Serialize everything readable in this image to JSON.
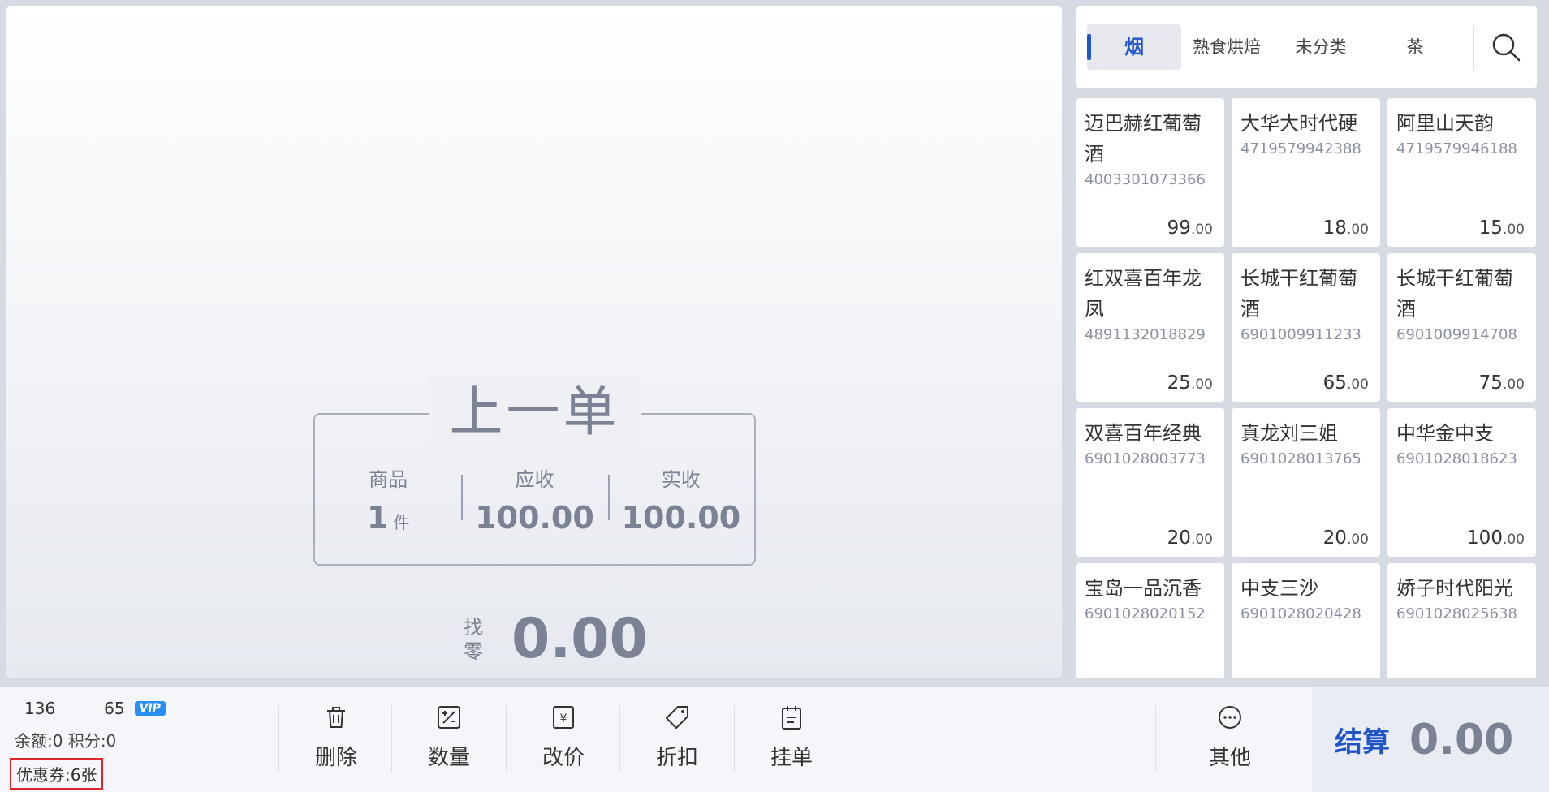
{
  "last_order": {
    "title": "上一单",
    "goods_label": "商品",
    "goods_count": "1",
    "goods_unit": "件",
    "receivable_label": "应收",
    "receivable_value": "100.00",
    "received_label": "实收",
    "received_value": "100.00",
    "change_label": "找零",
    "change_value": "0.00"
  },
  "categories": [
    {
      "label": "烟",
      "active": true
    },
    {
      "label": "熟食烘焙",
      "active": false
    },
    {
      "label": "未分类",
      "active": false
    },
    {
      "label": "茶",
      "active": false
    }
  ],
  "products": [
    {
      "name": "迈巴赫红葡萄酒",
      "code": "4003301073366",
      "price_int": "99",
      "price_dec": ".00"
    },
    {
      "name": "大华大时代硬",
      "code": "4719579942388",
      "price_int": "18",
      "price_dec": ".00"
    },
    {
      "name": "阿里山天韵",
      "code": "4719579946188",
      "price_int": "15",
      "price_dec": ".00"
    },
    {
      "name": "红双喜百年龙凤",
      "code": "4891132018829",
      "price_int": "25",
      "price_dec": ".00"
    },
    {
      "name": "长城干红葡萄酒",
      "code": "6901009911233",
      "price_int": "65",
      "price_dec": ".00"
    },
    {
      "name": "长城干红葡萄酒",
      "code": "6901009914708",
      "price_int": "75",
      "price_dec": ".00"
    },
    {
      "name": "双喜百年经典",
      "code": "6901028003773",
      "price_int": "20",
      "price_dec": ".00"
    },
    {
      "name": "真龙刘三姐",
      "code": "6901028013765",
      "price_int": "20",
      "price_dec": ".00"
    },
    {
      "name": "中华金中支",
      "code": "6901028018623",
      "price_int": "100",
      "price_dec": ".00"
    },
    {
      "name": "宝岛一品沉香",
      "code": "6901028020152",
      "price_int": "",
      "price_dec": ""
    },
    {
      "name": "中支三沙",
      "code": "6901028020428",
      "price_int": "",
      "price_dec": ""
    },
    {
      "name": "娇子时代阳光",
      "code": "6901028025638",
      "price_int": "",
      "price_dec": ""
    }
  ],
  "member": {
    "phone": "136      65",
    "vip": "VIP",
    "balance": "余额:0  积分:0",
    "coupon": "优惠券:6张"
  },
  "toolbar": {
    "delete": "删除",
    "quantity": "数量",
    "change_price": "改价",
    "discount": "折扣",
    "hold_order": "挂单",
    "other": "其他"
  },
  "settle": {
    "label": "结算",
    "amount": "0.00"
  }
}
